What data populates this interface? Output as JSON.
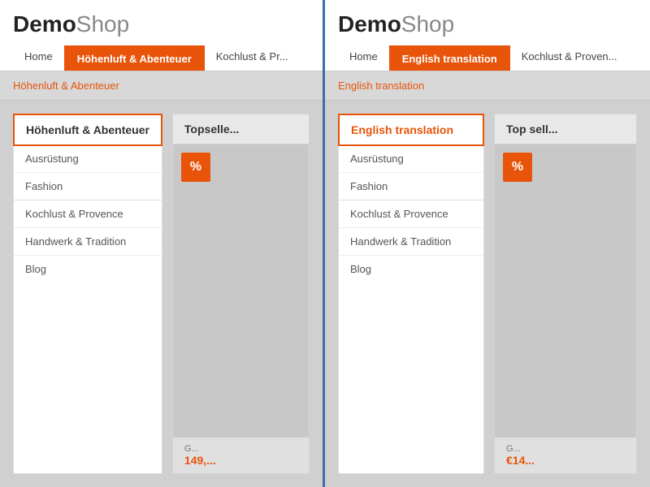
{
  "left": {
    "logo": {
      "demo": "Demo",
      "shop": "Shop"
    },
    "nav": {
      "items": [
        {
          "label": "Home",
          "active": false
        },
        {
          "label": "Höhenluft & Abenteuer",
          "active": true
        },
        {
          "label": "Kochlust & Pr...",
          "active": false
        }
      ]
    },
    "breadcrumb": "Höhenluft & Abenteuer",
    "dropdown": {
      "header": "Höhenluft & Abenteuer",
      "items": [
        {
          "label": "Ausrüstung",
          "group": true
        },
        {
          "label": "Fashion",
          "group": true
        },
        {
          "label": "Kochlust & Provence",
          "group": false
        },
        {
          "label": "Handwerk & Tradition",
          "group": false
        },
        {
          "label": "Blog",
          "group": false
        }
      ]
    },
    "topseller": {
      "header": "Topselle...",
      "percent": "%",
      "link": "G...",
      "price": "149,..."
    }
  },
  "right": {
    "logo": {
      "demo": "Demo",
      "shop": "Shop"
    },
    "nav": {
      "items": [
        {
          "label": "Home",
          "active": false
        },
        {
          "label": "English translation",
          "active": true
        },
        {
          "label": "Kochlust & Proven...",
          "active": false
        }
      ]
    },
    "breadcrumb": "English translation",
    "dropdown": {
      "header": "English translation",
      "items": [
        {
          "label": "Ausrüstung",
          "group": true
        },
        {
          "label": "Fashion",
          "group": true
        },
        {
          "label": "Kochlust & Provence",
          "group": false
        },
        {
          "label": "Handwerk & Tradition",
          "group": false
        },
        {
          "label": "Blog",
          "group": false
        }
      ]
    },
    "topseller": {
      "header": "Top sell...",
      "percent": "%",
      "link": "G...",
      "price": "€14..."
    }
  }
}
